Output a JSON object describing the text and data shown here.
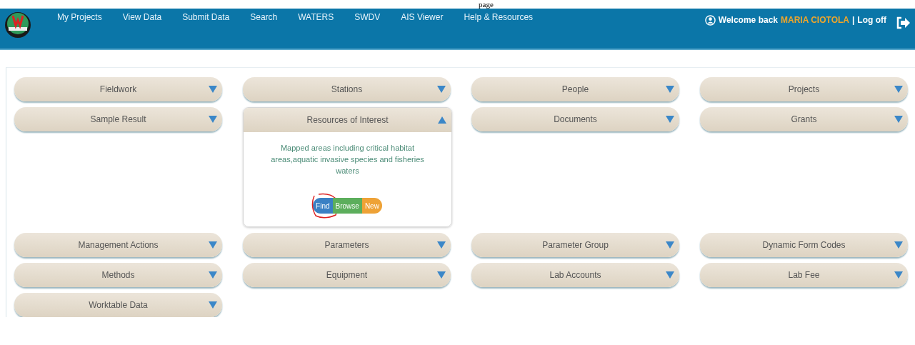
{
  "top_caption": "page",
  "header": {
    "nav": [
      "My Projects",
      "View Data",
      "Submit Data",
      "Search",
      "WATERS",
      "SWDV",
      "AIS Viewer",
      "Help & Resources"
    ],
    "welcome": "Welcome back",
    "user": "MARIA CIOTOLA",
    "separator": "|",
    "logoff": "Log off"
  },
  "panels": [
    {
      "title": "Fieldwork",
      "expanded": false
    },
    {
      "title": "Stations",
      "expanded": false
    },
    {
      "title": "People",
      "expanded": false
    },
    {
      "title": "Projects",
      "expanded": false
    },
    {
      "title": "Sample Result",
      "expanded": false
    },
    {
      "title": "Resources of Interest",
      "expanded": true,
      "description": "Mapped areas including critical habitat areas,aquatic invasive species and fisheries waters",
      "actions": [
        {
          "label": "Find",
          "color": "#3a80c4",
          "circled": true
        },
        {
          "label": "Browse",
          "color": "#5cae5c",
          "circled": false
        },
        {
          "label": "New",
          "color": "#eea236",
          "circled": false
        }
      ]
    },
    {
      "title": "Documents",
      "expanded": false
    },
    {
      "title": "Grants",
      "expanded": false
    },
    {
      "title": "Management Actions",
      "expanded": false
    },
    {
      "title": "Parameters",
      "expanded": false
    },
    {
      "title": "Parameter Group",
      "expanded": false
    },
    {
      "title": "Dynamic Form Codes",
      "expanded": false
    },
    {
      "title": "Methods",
      "expanded": false
    },
    {
      "title": "Equipment",
      "expanded": false
    },
    {
      "title": "Lab Accounts",
      "expanded": false
    },
    {
      "title": "Lab Fee",
      "expanded": false
    },
    {
      "title": "Worktable Data",
      "expanded": false
    }
  ]
}
